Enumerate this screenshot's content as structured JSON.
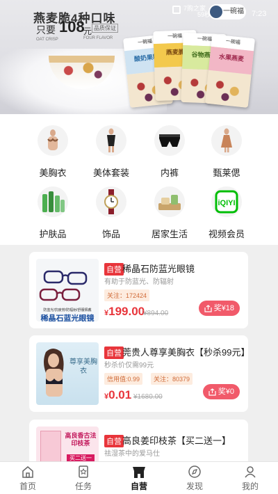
{
  "status_bar": {
    "home_text": "7购之家",
    "home_sub": "59秒",
    "time": "7:23",
    "brand": "一碗福"
  },
  "banner": {
    "headline": "燕麦脆4种口味",
    "price_prefix": "只要",
    "price": "108",
    "price_unit": "元",
    "tag": "品质保证",
    "small1": "OAT CRISP",
    "small2": "FOUR FLAVOR",
    "packs": [
      {
        "top": "一碗福",
        "name": "酸奶果粒",
        "bg": "#cfe3f2",
        "color": "#2d6fa8"
      },
      {
        "top": "一碗福",
        "name": "燕麦脆",
        "bg": "#f3c94d",
        "color": "#7b4a12"
      },
      {
        "top": "一碗福",
        "name": "谷物燕麦",
        "bg": "#d8ea9e",
        "color": "#3f6b1a"
      },
      {
        "top": "一碗福",
        "name": "水果燕麦",
        "bg": "#f2b7c6",
        "color": "#a02a4f"
      }
    ]
  },
  "categories": [
    {
      "label": "美胸衣",
      "icon": "bra-icon"
    },
    {
      "label": "美体套装",
      "icon": "bodysuit-icon"
    },
    {
      "label": "内裤",
      "icon": "underwear-icon"
    },
    {
      "label": "甄莱偲",
      "icon": "dress-icon"
    },
    {
      "label": "护肤品",
      "icon": "skincare-icon"
    },
    {
      "label": "饰品",
      "icon": "watch-icon"
    },
    {
      "label": "居家生活",
      "icon": "home-goods-icon"
    },
    {
      "label": "视频会员",
      "icon": "iqiyi-icon"
    }
  ],
  "products": [
    {
      "self_tag": "自营",
      "title": "稀晶石防蓝光眼镜",
      "desc": "有助于防蓝光、防辐射",
      "chips": [
        "关注：172424"
      ],
      "price_symbol": "¥",
      "price": "199.00",
      "old_price": "¥894.00",
      "reward": "奖¥18",
      "thumb_text": "稀晶石蓝光眼镜",
      "thumb_sub": "防蓝光/抗疲劳/防辐射/舒服佩戴"
    },
    {
      "self_tag": "自营",
      "title": "莞贵人尊享美胸衣【秒杀99元】",
      "desc": "秒杀价仅需99元",
      "chips": [
        "信用值:0.99",
        "关注：80379"
      ],
      "price_symbol": "¥",
      "price": "0.01",
      "old_price": "¥1680.00",
      "reward": "奖¥0",
      "thumb_text": "尊享美胸衣"
    },
    {
      "self_tag": "自营",
      "title": "高良姜印枝茶【买二送一】",
      "desc": "祛湿茶中的爱马仕",
      "thumb_text": "高良香古法印枝茶",
      "thumb_sub": "买二送一"
    }
  ],
  "nav": [
    {
      "label": "首页",
      "icon": "home-icon"
    },
    {
      "label": "任务",
      "icon": "task-icon"
    },
    {
      "label": "自营",
      "icon": "store-icon",
      "active": true
    },
    {
      "label": "发现",
      "icon": "compass-icon"
    },
    {
      "label": "我的",
      "icon": "user-icon"
    }
  ]
}
